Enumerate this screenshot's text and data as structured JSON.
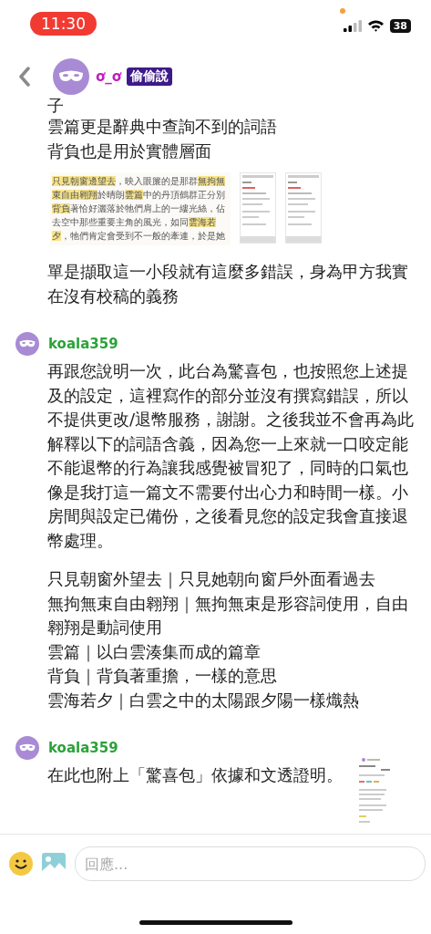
{
  "status_bar": {
    "time": "11:30",
    "battery": "38"
  },
  "header": {
    "name": "ơ_ơ",
    "badge": "偷偷說"
  },
  "messages": [
    {
      "blocks": [
        {
          "kind": "lines",
          "lines": [
            "子",
            "雲篇更是辭典中查詢不到的詞語",
            "背負也是用於實體層面"
          ]
        },
        {
          "kind": "images",
          "excerpt": [
            [
              {
                "text": "只見朝窗邊望去",
                "highlight": true
              },
              {
                "text": "，映入眼簾的是那群",
                "highlight": false
              },
              {
                "text": "無拘無",
                "highlight": true
              }
            ],
            [
              {
                "text": "束自由翱翔",
                "highlight": true
              },
              {
                "text": "於晴朗",
                "highlight": false
              },
              {
                "text": "雲篇",
                "highlight": true
              },
              {
                "text": "中的丹頂鶴群正分別",
                "highlight": false
              }
            ],
            [
              {
                "text": "背負",
                "highlight": true
              },
              {
                "text": "著恰好灑落於牠們肩上的一縷光絲，佔",
                "highlight": false
              }
            ],
            [
              {
                "text": "去空中那些重要主角的風光，如同",
                "highlight": false
              },
              {
                "text": "雲海若",
                "highlight": true
              }
            ],
            [
              {
                "text": "夕",
                "highlight": true
              },
              {
                "text": "，牠們肯定會受到不一般的牽連，於是她",
                "highlight": false
              }
            ]
          ]
        },
        {
          "kind": "paragraph",
          "text": "單是擷取這一小段就有這麼多錯誤，身為甲方我實在沒有校稿的義務"
        }
      ]
    },
    {
      "author": "koala359",
      "blocks": [
        {
          "kind": "paragraph",
          "text": "再跟您說明一次，此台為驚喜包，也按照您上述提及的設定，這裡寫作的部分並沒有撰寫錯誤，所以不提供更改/退幣服務，謝謝。之後我並不會再為此解釋以下的詞語含義，因為您一上來就一口咬定能不能退幣的行為讓我感覺被冒犯了，同時的口氣也像是我打這一篇文不需要付出心力和時間一樣。小房間與設定已備份，之後看見您的設定我會直接退幣處理。"
        },
        {
          "kind": "lines",
          "lines": [
            "只見朝窗外望去｜只見她朝向窗戶外面看過去",
            "無拘無束自由翱翔｜無拘無束是形容詞使用，自由翱翔是動詞使用",
            "雲篇｜以白雲湊集而成的篇章",
            "背負｜背負著重擔，一樣的意思",
            "雲海若夕｜白雲之中的太陽跟夕陽一樣熾熱"
          ]
        }
      ]
    },
    {
      "author": "koala359",
      "blocks": [
        {
          "kind": "text_with_image",
          "text": "在此也附上「驚喜包」依據和文透證明。"
        }
      ]
    }
  ],
  "composer": {
    "placeholder": "回應..."
  }
}
